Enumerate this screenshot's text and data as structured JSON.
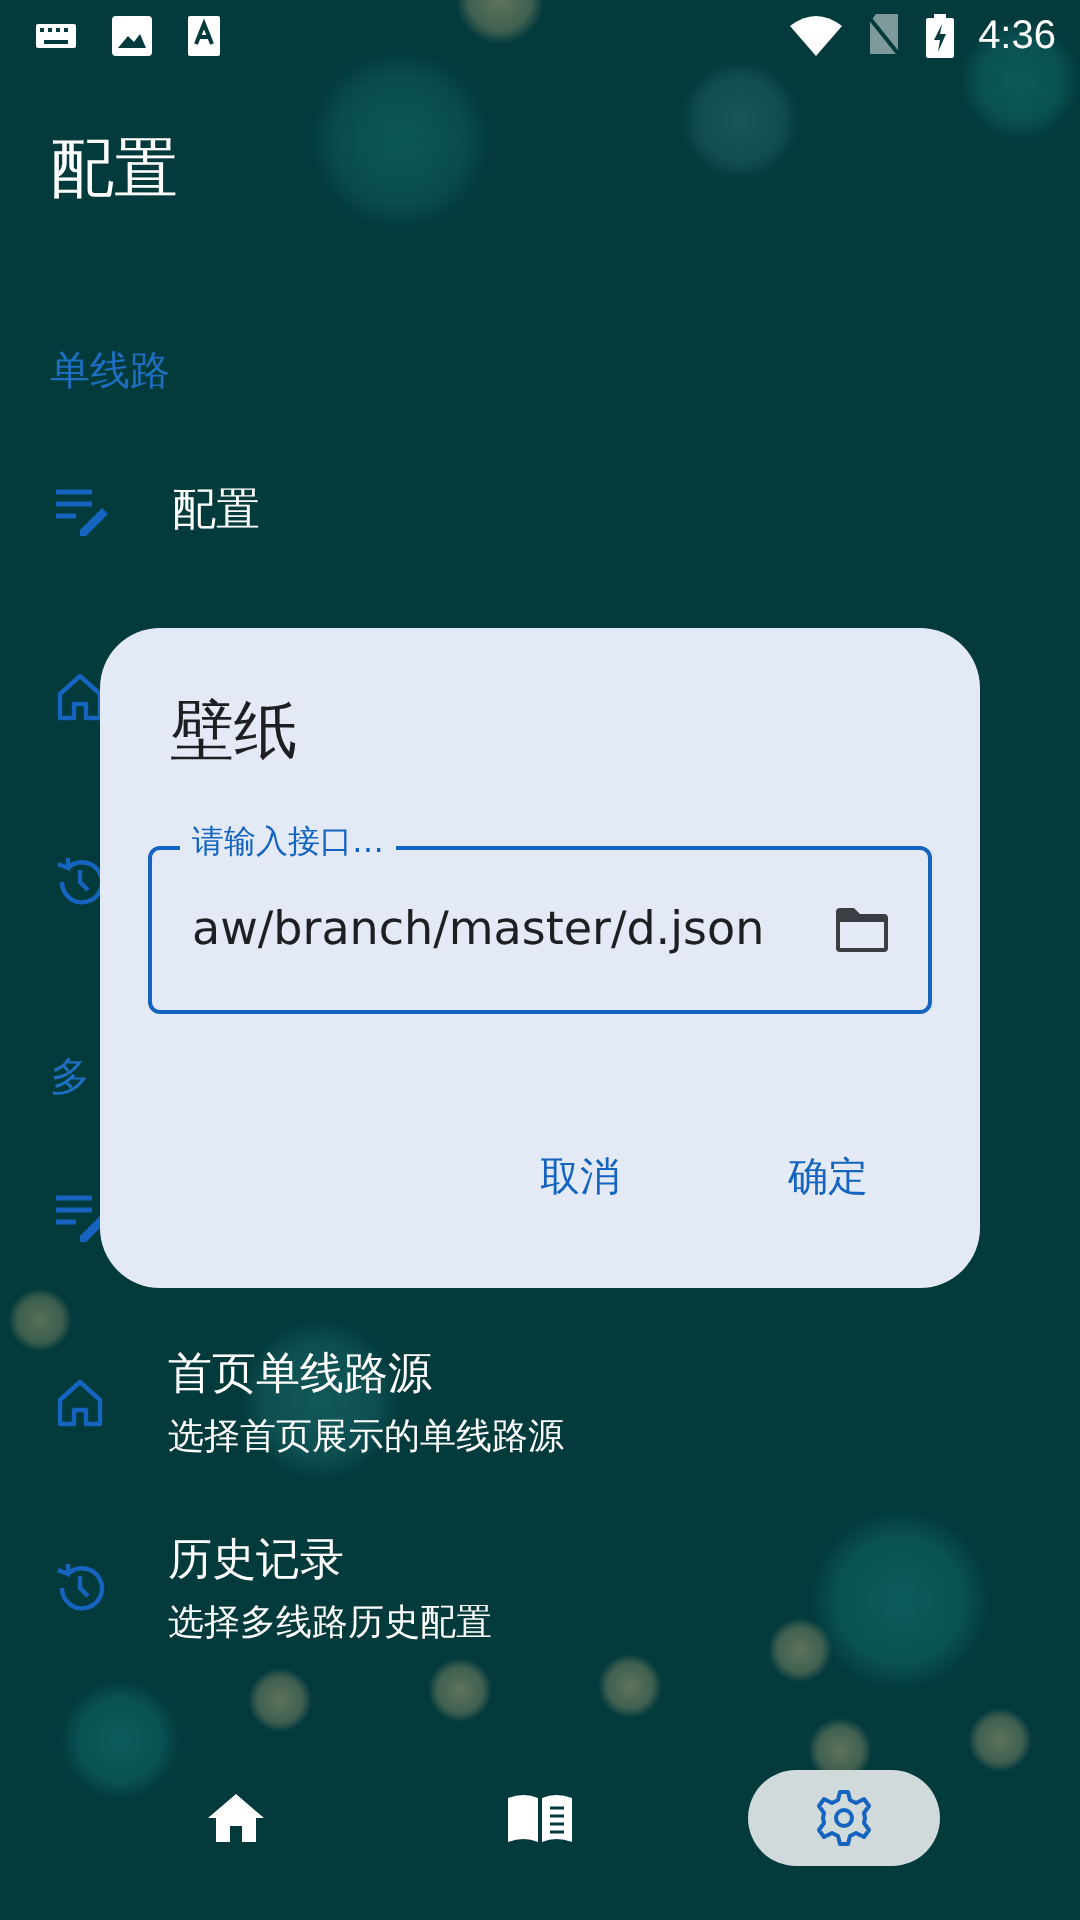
{
  "status_bar": {
    "time": "4:36"
  },
  "app_bar": {
    "title": "配置"
  },
  "sections": [
    {
      "header": "单线路",
      "items": [
        {
          "kind": "edit",
          "title": "配置"
        },
        {
          "kind": "home"
        },
        {
          "kind": "history"
        }
      ]
    },
    {
      "header": "多",
      "items": [
        {
          "kind": "edit"
        },
        {
          "kind": "home",
          "title": "首页单线路源",
          "subtitle": "选择首页展示的单线路源"
        },
        {
          "kind": "history",
          "title": "历史记录",
          "subtitle": "选择多线路历史配置"
        }
      ]
    }
  ],
  "dialog": {
    "title": "壁纸",
    "field": {
      "label": "请输入接口…",
      "value": "aw/branch/master/d.json"
    },
    "buttons": [
      "取消",
      "确定"
    ]
  },
  "bottom_nav": [
    {
      "kind": "home",
      "selected": false
    },
    {
      "kind": "book",
      "selected": false
    },
    {
      "kind": "settings",
      "selected": true
    }
  ]
}
